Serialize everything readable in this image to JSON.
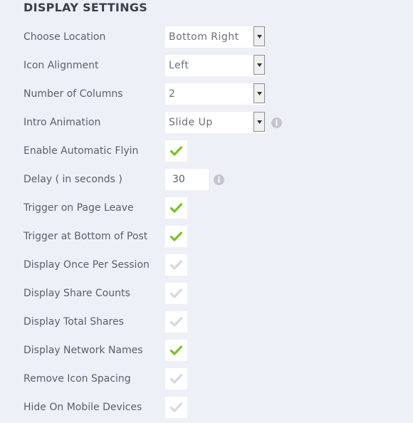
{
  "section": {
    "title": "DISPLAY SETTINGS"
  },
  "colors": {
    "check_on": "#7ac02a",
    "check_off": "#d6d8dc"
  },
  "settings": {
    "location": {
      "label": "Choose Location",
      "value": "Bottom Right"
    },
    "icon_alignment": {
      "label": "Icon Alignment",
      "value": "Left"
    },
    "columns": {
      "label": "Number of Columns",
      "value": "2"
    },
    "intro_animation": {
      "label": "Intro Animation",
      "value": "Slide Up"
    },
    "auto_flyin": {
      "label": "Enable Automatic Flyin",
      "checked": true
    },
    "delay": {
      "label": "Delay ( in seconds )",
      "value": "30"
    },
    "page_leave": {
      "label": "Trigger on Page Leave",
      "checked": true
    },
    "bottom_of_post": {
      "label": "Trigger at Bottom of Post",
      "checked": true
    },
    "once_per_session": {
      "label": "Display Once Per Session",
      "checked": false
    },
    "share_counts": {
      "label": "Display Share Counts",
      "checked": false
    },
    "total_shares": {
      "label": "Display Total Shares",
      "checked": false
    },
    "network_names": {
      "label": "Display Network Names",
      "checked": true
    },
    "icon_spacing": {
      "label": "Remove Icon Spacing",
      "checked": false
    },
    "hide_mobile": {
      "label": "Hide On Mobile Devices",
      "checked": false
    }
  }
}
